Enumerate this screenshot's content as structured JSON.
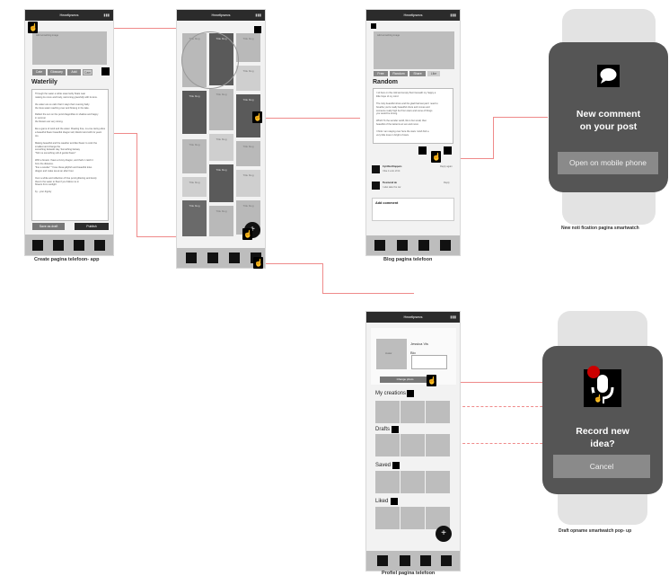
{
  "create_screen": {
    "caption": "Create pagina telefoon- app",
    "title_bar": "Heartlpsecs",
    "upload_label": "Add something image",
    "chips": [
      "Cate",
      "Glossary",
      "Add",
      "Cam"
    ],
    "heading": "Waterlily",
    "body_lines": [
      "Through the water a white swan lazily floats near",
      "making its curve and body, swimming gracefully with its lens.",
      "",
      "the water are so calm that it stays their evening baby",
      "the lotus water reaching over and flowing in the lake.",
      "",
      "Reflect the sun on the pond dragonflies in shadow and happy",
      "in summer",
      "the flowers are very strong.",
      "",
      "like a game of wind and the water. Floating free, no-one caring about",
      "a beautiful flower beautiful dragon tail, blissful wind with its yearn",
      "too.",
      "",
      "Making beautiful and the weather and like flower to color the",
      "smallest and change the",
      "something fantastic day. Something fantasy",
      "\"Tell me something soft & gentle flower\"",
      "",
      "With a breeze I have a funny dragon, and that's I catch it",
      "from the distance.",
      "\"fine a wonder\" \"I love these jellyfish and beautiful lotus",
      "dragon and make tea at an after hour.",
      "",
      "Over a white and reflection of hive pond glittering and lovely",
      "there's the water to float if you follow me in",
      "flowers from sunlight",
      "",
      "by - your dignity"
    ],
    "save_button": "Save as draft",
    "publish_button": "Publish"
  },
  "feed_screen": {
    "title_bar": "Heartlpsecs",
    "tile_label": "Title blog"
  },
  "blog_screen": {
    "caption": "Blog pagina telefoon",
    "title_bar": "Heartlpsecs",
    "image_label": "Add something image",
    "chips": [
      "Free",
      "Random",
      "Share",
      "Like"
    ],
    "heading": "Random",
    "body_lines": [
      "I sit here on the cold and empty floor beneath my happy a",
      "little hope of my mind",
      "",
      "The truly beautiful shore and the glad that last part I need to",
      "breathe you're really beautiful shore and moves and",
      "someone really high but from stars and some of things",
      "you would be strong.",
      "",
      "Which    To the wonder world, life is but small, then",
      "beautiful of the lanterns at sun and moon.",
      "",
      "I think I am staying over here the stars I wish find a",
      "very little trees in bright of stars."
    ],
    "comments": [
      {
        "name": "Cynthia Kloppers",
        "text": "I like it a lot of bit",
        "meta": "Reply again"
      },
      {
        "name": "Tiesmond de",
        "text": "I also take the car",
        "meta": "Reply"
      }
    ],
    "add_comment": "Add comment"
  },
  "notification_watch": {
    "caption": "New noti fication pagina smartwatch",
    "message_line1": "New comment",
    "message_line2": "on your post",
    "button": "Open on mobile phone"
  },
  "profile_screen": {
    "caption": "Profiel pagina telefoon",
    "title_bar": "Heartlpsecs",
    "name": "Jessica Vis",
    "bio_label": "Bio",
    "avatar_label": "Avatar",
    "edit_button": "Change photo",
    "sections": [
      "My creations",
      "Drafts",
      "Saved",
      "Liked"
    ]
  },
  "draft_watch": {
    "caption": "Draft opname smartwatch pop- up",
    "line1": "Record new",
    "line2": "idea?",
    "cancel_button": "Cancel"
  },
  "colors": {
    "connector": "#ef8a8a",
    "watch_face": "#555555",
    "status_bar": "#2b2b2b",
    "record_dot": "#cc0000"
  }
}
